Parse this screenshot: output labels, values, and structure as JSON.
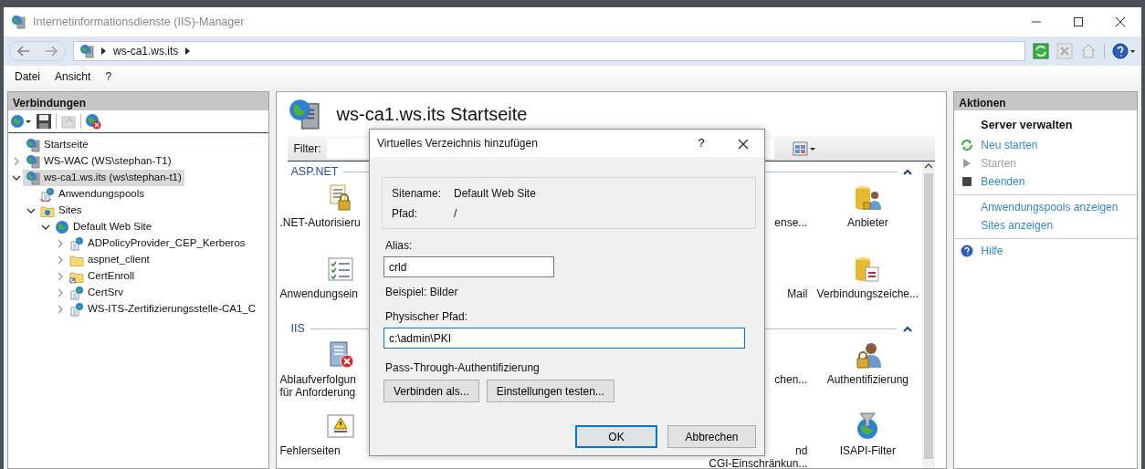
{
  "window": {
    "title": "Internetinformationsdienste (IIS)-Manager"
  },
  "address_bar": {
    "crumbs": [
      "ws-ca1.ws.its"
    ]
  },
  "menu": [
    "Datei",
    "Ansicht",
    "?"
  ],
  "connections": {
    "title": "Verbindungen",
    "tree": [
      {
        "label": "Startseite",
        "kind": "server",
        "selected": false
      },
      {
        "label": "WS-WAC (WS\\stephan-T1)",
        "kind": "server",
        "selected": false,
        "expanded": false
      },
      {
        "label": "ws-ca1.ws.its (ws\\stephan-t1)",
        "kind": "server",
        "selected": true,
        "expanded": true,
        "children": [
          {
            "label": "Anwendungspools",
            "kind": "pool",
            "selected": false
          },
          {
            "label": "Sites",
            "kind": "sites",
            "selected": false,
            "expanded": true,
            "children": [
              {
                "label": "Default Web Site",
                "kind": "site",
                "selected": false,
                "expanded": true,
                "children": [
                  {
                    "label": "ADPolicyProvider_CEP_Kerberos",
                    "kind": "app",
                    "selected": false,
                    "expanded": false
                  },
                  {
                    "label": "aspnet_client",
                    "kind": "folder",
                    "selected": false,
                    "expanded": false
                  },
                  {
                    "label": "CertEnroll",
                    "kind": "vdir",
                    "selected": false,
                    "expanded": false
                  },
                  {
                    "label": "CertSrv",
                    "kind": "app",
                    "selected": false,
                    "expanded": false
                  },
                  {
                    "label": "WS-ITS-Zertifizierungsstelle-CA1_C",
                    "kind": "app",
                    "selected": false,
                    "expanded": false
                  }
                ]
              }
            ]
          }
        ]
      }
    ]
  },
  "home": {
    "title": "ws-ca1.ws.its Startseite",
    "filter_label": "Filter:",
    "groups": [
      {
        "title": "ASP.NET",
        "expanded": true,
        "rows": [
          {
            "left": {
              "kind": "auth-rules",
              "label": ".NET-Autorisieru"
            },
            "partial": {
              "label": "ense..."
            },
            "right": {
              "kind": "providers",
              "label": "Anbieter"
            }
          },
          {
            "left": {
              "kind": "app-settings",
              "label": "Anwendungsein"
            },
            "partial": {
              "label": "Mail"
            },
            "right": {
              "kind": "conn-strings",
              "label": "Verbindungszeiche..."
            }
          }
        ]
      },
      {
        "title": "IIS",
        "expanded": true,
        "rows": [
          {
            "left": {
              "kind": "trace",
              "label": "Ablaufverfolgun\nfür Anforderung"
            },
            "partial": {
              "label": "chen..."
            },
            "right": {
              "kind": "authentication",
              "label": "Authentifizierung"
            }
          },
          {
            "left": {
              "kind": "error-pages",
              "label": "Fehlerseiten"
            },
            "partial": {
              "label": "nd\nCGI-Einschränkun..."
            },
            "right": {
              "kind": "isapi",
              "label": "ISAPI-Filter"
            }
          }
        ]
      }
    ]
  },
  "actions": {
    "title": "Aktionen",
    "groups": [
      {
        "title": "Server verwalten",
        "items": [
          {
            "label": "Neu starten",
            "kind": "restart",
            "disabled": false
          },
          {
            "label": "Starten",
            "kind": "start",
            "disabled": true
          },
          {
            "label": "Beenden",
            "kind": "stop",
            "disabled": false
          }
        ]
      },
      {
        "items": [
          {
            "label": "Anwendungspools anzeigen",
            "kind": "link",
            "disabled": false
          },
          {
            "label": "Sites anzeigen",
            "kind": "link",
            "disabled": false
          }
        ]
      },
      {
        "items": [
          {
            "label": "Hilfe",
            "kind": "help",
            "disabled": false
          }
        ]
      }
    ]
  },
  "dialog": {
    "title": "Virtuelles Verzeichnis hinzufügen",
    "help": "?",
    "info": [
      {
        "label": "Sitename:",
        "value": "Default Web Site"
      },
      {
        "label": "Pfad:",
        "value": "/"
      }
    ],
    "alias": {
      "label": "Alias:",
      "value": "crld",
      "focused": false
    },
    "alias_example": "Beispiel: Bilder",
    "physical_path": {
      "label": "Physischer Pfad:",
      "value": "c:\\admin\\PKI",
      "focused": true
    },
    "auth_label": "Pass-Through-Authentifizierung",
    "auth_buttons": [
      "Verbinden als...",
      "Einstellungen testen..."
    ],
    "buttons": [
      {
        "label": "OK",
        "default": true
      },
      {
        "label": "Abbrechen",
        "default": false
      }
    ]
  }
}
